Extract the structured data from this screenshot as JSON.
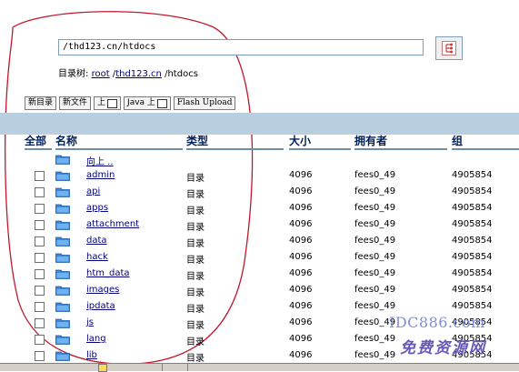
{
  "path_input": {
    "value": "/thd123.cn/htdocs"
  },
  "tree": {
    "label": "目录树:",
    "crumbs": [
      "root",
      "thd123.cn"
    ],
    "current": "htdocs"
  },
  "toolbar": {
    "new_dir": "新目录",
    "new_file": "新文件",
    "up": "上",
    "java_up": "Java 上",
    "flash_upload": "Flash Upload"
  },
  "columns": {
    "all": "全部",
    "name": "名称",
    "type": "类型",
    "size": "大小",
    "owner": "拥有者",
    "group": "组"
  },
  "parent_row": {
    "label": "向上 .."
  },
  "rows": [
    {
      "name": "admin",
      "type": "目录",
      "size": "4096",
      "owner": "fees0_49",
      "group": "4905854"
    },
    {
      "name": "api",
      "type": "目录",
      "size": "4096",
      "owner": "fees0_49",
      "group": "4905854"
    },
    {
      "name": "apps",
      "type": "目录",
      "size": "4096",
      "owner": "fees0_49",
      "group": "4905854"
    },
    {
      "name": "attachment",
      "type": "目录",
      "size": "4096",
      "owner": "fees0_49",
      "group": "4905854"
    },
    {
      "name": "data",
      "type": "目录",
      "size": "4096",
      "owner": "fees0_49",
      "group": "4905854"
    },
    {
      "name": "hack",
      "type": "目录",
      "size": "4096",
      "owner": "fees0_49",
      "group": "4905854"
    },
    {
      "name": "htm_data",
      "type": "目录",
      "size": "4096",
      "owner": "fees0_49",
      "group": "4905854"
    },
    {
      "name": "images",
      "type": "目录",
      "size": "4096",
      "owner": "fees0_49",
      "group": "4905854"
    },
    {
      "name": "ipdata",
      "type": "目录",
      "size": "4096",
      "owner": "fees0_49",
      "group": "4905854"
    },
    {
      "name": "js",
      "type": "目录",
      "size": "4096",
      "owner": "fees0_49",
      "group": "4905854"
    },
    {
      "name": "lang",
      "type": "目录",
      "size": "4096",
      "owner": "fees0_49",
      "group": "4905854"
    },
    {
      "name": "lib",
      "type": "目录",
      "size": "4096",
      "owner": "fees0_49",
      "group": "4905854"
    }
  ],
  "watermark": {
    "line1": "IDC886.com",
    "line2": "免费资源网"
  },
  "colors": {
    "band": "#b9cfdf",
    "header_text": "#00205a",
    "link": "#000080",
    "annotation": "#c0182c"
  },
  "icons": {
    "go": "network-tree-icon",
    "folder": "folder-icon"
  }
}
